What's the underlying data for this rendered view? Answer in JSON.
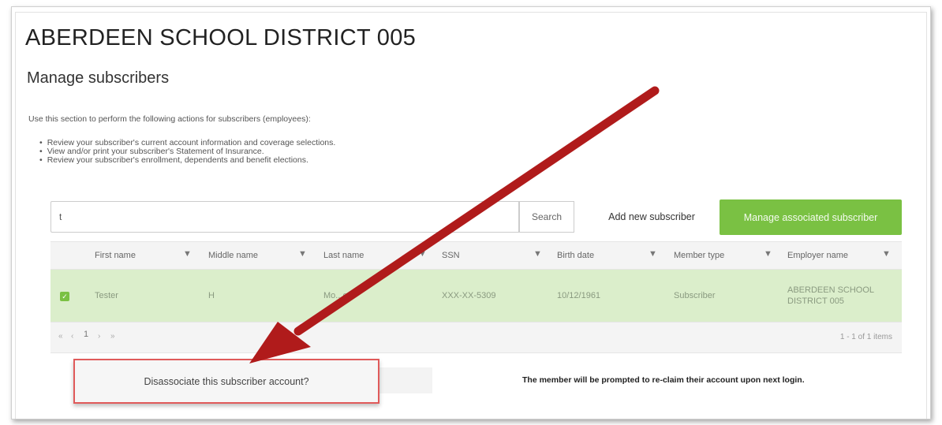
{
  "page": {
    "org_title": "ABERDEEN SCHOOL DISTRICT 005",
    "section_title": "Manage subscribers",
    "intro": "Use this section to perform the following actions for subscribers (employees):",
    "bullets": [
      "Review your subscriber's current account information and coverage selections.",
      "View and/or print your subscriber's Statement of Insurance.",
      "Review your subscriber's enrollment, dependents and benefit elections."
    ]
  },
  "toolbar": {
    "search_value": "t",
    "search_label": "Search",
    "add_label": "Add new subscriber",
    "manage_label": "Manage associated subscriber"
  },
  "grid": {
    "columns": [
      "First name",
      "Middle name",
      "Last name",
      "SSN",
      "Birth date",
      "Member type",
      "Employer name"
    ],
    "row": {
      "first_name": "Tester",
      "middle_name": "H",
      "last_name": "Mo...e",
      "ssn": "XXX-XX-5309",
      "birth_date": "10/12/1961",
      "member_type": "Subscriber",
      "employer_name": "ABERDEEN SCHOOL DISTRICT 005"
    },
    "pager": {
      "first": "«",
      "prev": "‹",
      "page": "1",
      "next": "›",
      "last": "»",
      "items_text": "1 - 1 of 1 items"
    }
  },
  "actions": {
    "disassociate_label": "Disassociate this subscriber account?",
    "notice": "The member will be prompted to re-claim their account upon next login."
  },
  "colors": {
    "accent_green": "#7ac143",
    "selected_row": "#dbeecb",
    "arrow_red": "#b01b1b",
    "highlight_red": "#e05a5a"
  },
  "icons": [
    "filter-icon",
    "checkbox-checked-icon",
    "arrow-annotation"
  ]
}
